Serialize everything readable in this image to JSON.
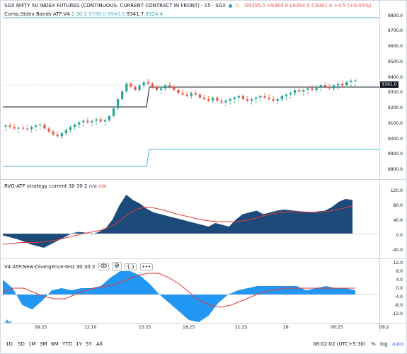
{
  "symbol": {
    "title": "SGX NIFTY 50 INDEX FUTURES (CONTINUOUS: CURRENT CONTRACT IN FRONT) · 15 · SGX",
    "badge": "D",
    "open": "O9355.5",
    "high": "H9364.0",
    "low": "L9354.0",
    "close": "C9361.0",
    "change": "+4.5 (+0.05%)"
  },
  "indicator1": {
    "name": "Comp.Stdev Bands-ATF:V4",
    "params": "1 30 2",
    "v1": "9788.0",
    "v2": "8940.0",
    "v3": "9341.7",
    "v4": "9324.4"
  },
  "indicator2": {
    "name": "RVG-ATF strategy current",
    "params": "30 30 2",
    "v1": "n/a",
    "v2": "n/a"
  },
  "indicator3": {
    "name": "V4 ATF:New-Divergence-test",
    "params": "30 30 2",
    "more": "•••"
  },
  "price_axis": [
    "9800.0",
    "9700.0",
    "9600.0",
    "9500.0",
    "9400.0",
    "9300.0",
    "9200.0",
    "9100.0",
    "9000.0",
    "8900.0",
    "8800.0"
  ],
  "last_price": "9361.0",
  "pane2_axis": [
    "120.0",
    "80.0",
    "40.0",
    "0.0",
    "-40.0"
  ],
  "pane3_axis": [
    "12.0",
    "8.0",
    "4.0",
    "0.0",
    "-4.0",
    "-8.0",
    "-12.0"
  ],
  "time_axis": [
    "09:25",
    "12:10",
    "15:25",
    "18:25",
    "21:25",
    "28",
    "06:25",
    "09:2"
  ],
  "intervals": [
    "1D",
    "5D",
    "1M",
    "3M",
    "6M",
    "YTD",
    "1Y",
    "5Y",
    "All"
  ],
  "status": {
    "clock": "08:02:02 (UTC+5:30)",
    "percent": "%",
    "log": "log",
    "auto": "auto"
  },
  "colors": {
    "up": "#26a69a",
    "down": "#ef5350",
    "band": "#4fb3d9",
    "stepline": "#131722",
    "area_dark": "#1c4a7a",
    "area_light": "#2196f3",
    "signal_red": "#e53935"
  },
  "icons": {
    "eye": "eye-icon",
    "settings": "gear-icon",
    "source": "braces-icon",
    "more": "more-icon"
  }
}
